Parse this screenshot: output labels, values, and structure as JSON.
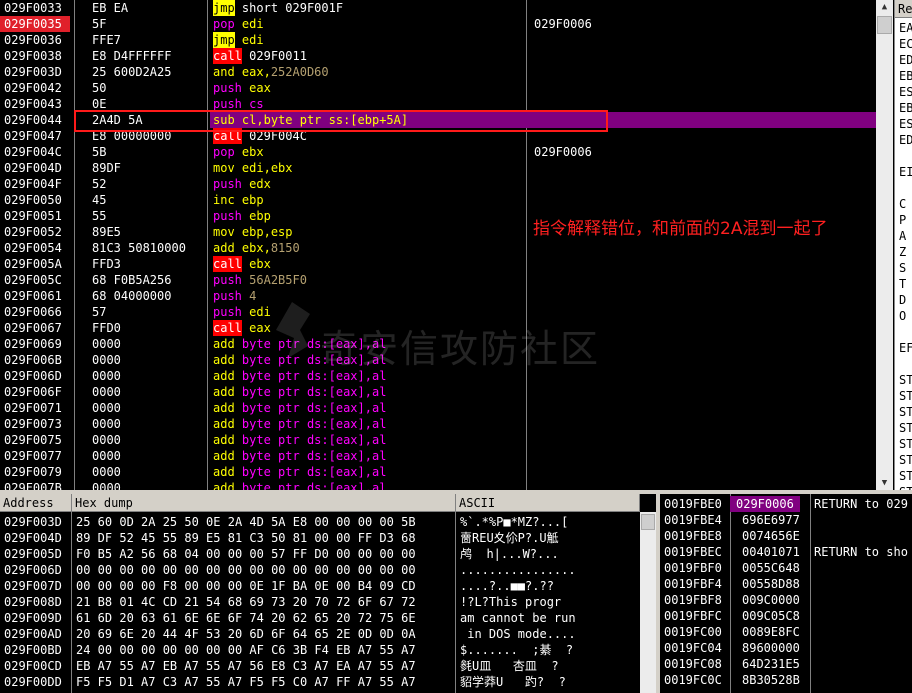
{
  "disasm": [
    {
      "addr": "029F0033",
      "hex": "EB EA",
      "mn": "jmp",
      "mnc": "m-jmp",
      "ops": [
        {
          "t": "short 029F001F",
          "c": ""
        }
      ],
      "cmt": ""
    },
    {
      "addr": "029F0035",
      "hex": "5F",
      "mn": "pop",
      "mnc": "m-pop",
      "ops": [
        {
          "t": "edi",
          "c": "op-y"
        }
      ],
      "cmt": "029F0006",
      "hl": true
    },
    {
      "addr": "029F0036",
      "hex": "FFE7",
      "mn": "jmp",
      "mnc": "m-jmp",
      "ops": [
        {
          "t": "edi",
          "c": "op-y"
        }
      ],
      "cmt": ""
    },
    {
      "addr": "029F0038",
      "hex": "E8 D4FFFFFF",
      "mn": "call",
      "mnc": "m-call",
      "ops": [
        {
          "t": "029F0011",
          "c": ""
        }
      ],
      "cmt": ""
    },
    {
      "addr": "029F003D",
      "hex": "25 600D2A25",
      "mn": "and",
      "mnc": "m-and",
      "ops": [
        {
          "t": "eax,",
          "c": "op-y"
        },
        {
          "t": "252A0D60",
          "c": "op-o"
        }
      ],
      "cmt": ""
    },
    {
      "addr": "029F0042",
      "hex": "50",
      "mn": "push",
      "mnc": "m-push",
      "ops": [
        {
          "t": "eax",
          "c": "op-y"
        }
      ],
      "cmt": ""
    },
    {
      "addr": "029F0043",
      "hex": "0E",
      "mn": "push",
      "mnc": "m-push",
      "ops": [
        {
          "t": "cs",
          "c": "op-m"
        }
      ],
      "cmt": ""
    },
    {
      "addr": "029F0044",
      "hex": "2A4D 5A",
      "mn": "sub",
      "mnc": "m-sub",
      "ops": [
        {
          "t": "cl,byte ptr ss:[ebp+5A]",
          "c": "op-y"
        }
      ],
      "cmt": "",
      "sel": true
    },
    {
      "addr": "029F0047",
      "hex": "E8 00000000",
      "mn": "call",
      "mnc": "m-call",
      "ops": [
        {
          "t": "029F004C",
          "c": ""
        }
      ],
      "cmt": ""
    },
    {
      "addr": "029F004C",
      "hex": "5B",
      "mn": "pop",
      "mnc": "m-pop",
      "ops": [
        {
          "t": "ebx",
          "c": "op-y"
        }
      ],
      "cmt": "029F0006"
    },
    {
      "addr": "029F004D",
      "hex": "89DF",
      "mn": "mov",
      "mnc": "m-mov",
      "ops": [
        {
          "t": "edi,ebx",
          "c": "op-y"
        }
      ],
      "cmt": ""
    },
    {
      "addr": "029F004F",
      "hex": "52",
      "mn": "push",
      "mnc": "m-push",
      "ops": [
        {
          "t": "edx",
          "c": "op-y"
        }
      ],
      "cmt": ""
    },
    {
      "addr": "029F0050",
      "hex": "45",
      "mn": "inc",
      "mnc": "m-inc",
      "ops": [
        {
          "t": "ebp",
          "c": "op-y"
        }
      ],
      "cmt": ""
    },
    {
      "addr": "029F0051",
      "hex": "55",
      "mn": "push",
      "mnc": "m-push",
      "ops": [
        {
          "t": "ebp",
          "c": "op-y"
        }
      ],
      "cmt": ""
    },
    {
      "addr": "029F0052",
      "hex": "89E5",
      "mn": "mov",
      "mnc": "m-mov",
      "ops": [
        {
          "t": "ebp,esp",
          "c": "op-y"
        }
      ],
      "cmt": ""
    },
    {
      "addr": "029F0054",
      "hex": "81C3 50810000",
      "mn": "add",
      "mnc": "m-add",
      "ops": [
        {
          "t": "ebx,",
          "c": "op-y"
        },
        {
          "t": "8150",
          "c": "op-o"
        }
      ],
      "cmt": ""
    },
    {
      "addr": "029F005A",
      "hex": "FFD3",
      "mn": "call",
      "mnc": "m-call",
      "ops": [
        {
          "t": "ebx",
          "c": "op-y"
        }
      ],
      "cmt": ""
    },
    {
      "addr": "029F005C",
      "hex": "68 F0B5A256",
      "mn": "push",
      "mnc": "m-push",
      "ops": [
        {
          "t": "56A2B5F0",
          "c": "op-o"
        }
      ],
      "cmt": ""
    },
    {
      "addr": "029F0061",
      "hex": "68 04000000",
      "mn": "push",
      "mnc": "m-push",
      "ops": [
        {
          "t": "4",
          "c": "op-o"
        }
      ],
      "cmt": ""
    },
    {
      "addr": "029F0066",
      "hex": "57",
      "mn": "push",
      "mnc": "m-push",
      "ops": [
        {
          "t": "edi",
          "c": "op-y"
        }
      ],
      "cmt": ""
    },
    {
      "addr": "029F0067",
      "hex": "FFD0",
      "mn": "call",
      "mnc": "m-call",
      "ops": [
        {
          "t": "eax",
          "c": "op-y"
        }
      ],
      "cmt": ""
    },
    {
      "addr": "029F0069",
      "hex": "0000",
      "mn": "add",
      "mnc": "m-add",
      "ops": [
        {
          "t": "byte ptr ds:[eax],al",
          "c": "op-m"
        }
      ],
      "cmt": ""
    },
    {
      "addr": "029F006B",
      "hex": "0000",
      "mn": "add",
      "mnc": "m-add",
      "ops": [
        {
          "t": "byte ptr ds:[eax],al",
          "c": "op-m"
        }
      ],
      "cmt": ""
    },
    {
      "addr": "029F006D",
      "hex": "0000",
      "mn": "add",
      "mnc": "m-add",
      "ops": [
        {
          "t": "byte ptr ds:[eax],al",
          "c": "op-m"
        }
      ],
      "cmt": ""
    },
    {
      "addr": "029F006F",
      "hex": "0000",
      "mn": "add",
      "mnc": "m-add",
      "ops": [
        {
          "t": "byte ptr ds:[eax],al",
          "c": "op-m"
        }
      ],
      "cmt": ""
    },
    {
      "addr": "029F0071",
      "hex": "0000",
      "mn": "add",
      "mnc": "m-add",
      "ops": [
        {
          "t": "byte ptr ds:[eax],al",
          "c": "op-m"
        }
      ],
      "cmt": ""
    },
    {
      "addr": "029F0073",
      "hex": "0000",
      "mn": "add",
      "mnc": "m-add",
      "ops": [
        {
          "t": "byte ptr ds:[eax],al",
          "c": "op-m"
        }
      ],
      "cmt": ""
    },
    {
      "addr": "029F0075",
      "hex": "0000",
      "mn": "add",
      "mnc": "m-add",
      "ops": [
        {
          "t": "byte ptr ds:[eax],al",
          "c": "op-m"
        }
      ],
      "cmt": ""
    },
    {
      "addr": "029F0077",
      "hex": "0000",
      "mn": "add",
      "mnc": "m-add",
      "ops": [
        {
          "t": "byte ptr ds:[eax],al",
          "c": "op-m"
        }
      ],
      "cmt": ""
    },
    {
      "addr": "029F0079",
      "hex": "0000",
      "mn": "add",
      "mnc": "m-add",
      "ops": [
        {
          "t": "byte ptr ds:[eax],al",
          "c": "op-m"
        }
      ],
      "cmt": ""
    },
    {
      "addr": "029F007B",
      "hex": "0000",
      "mn": "add",
      "mnc": "m-add",
      "ops": [
        {
          "t": "byte ptr ds:[eax],al",
          "c": "op-m"
        }
      ],
      "cmt": ""
    }
  ],
  "annotation": "指令解释错位，和前面的2A混到一起了",
  "watermark": "奇安信攻防社区",
  "registers": {
    "header": "Re",
    "labels": [
      "EA",
      "EC",
      "ED",
      "EB",
      "ES",
      "EB",
      "ES",
      "ED",
      "",
      "EI",
      "",
      "C",
      "P",
      "A",
      "Z",
      "S",
      "T",
      "D",
      "O",
      "",
      "EF",
      "",
      "ST",
      "ST",
      "ST",
      "ST",
      "ST",
      "ST",
      "ST",
      "ST"
    ]
  },
  "dump": {
    "headers": {
      "address": "Address",
      "hex": "Hex dump",
      "ascii": "ASCII"
    },
    "rows": [
      {
        "addr": "029F003D",
        "hex": "25 60 0D 2A 25 50 0E 2A 4D 5A E8 00 00 00 00 5B",
        "ascii": "%`.*%P■*MZ?...["
      },
      {
        "addr": "029F004D",
        "hex": "89 DF 52 45 55 89 E5 81 C3 50 81 00 00 FF D3 68",
        "ascii": "夁REU夊伱P?.U觝"
      },
      {
        "addr": "029F005D",
        "hex": "F0 B5 A2 56 68 04 00 00 00 57 FF D0 00 00 00 00",
        "ascii": "鸬  h|...W?..."
      },
      {
        "addr": "029F006D",
        "hex": "00 00 00 00 00 00 00 00 00 00 00 00 00 00 00 00",
        "ascii": "................"
      },
      {
        "addr": "029F007D",
        "hex": "00 00 00 00 F8 00 00 00 0E 1F BA 0E 00 B4 09 CD",
        "ascii": "....?..■■?.??"
      },
      {
        "addr": "029F008D",
        "hex": "21 B8 01 4C CD 21 54 68 69 73 20 70 72 6F 67 72",
        "ascii": "!?L?This progr"
      },
      {
        "addr": "029F009D",
        "hex": "61 6D 20 63 61 6E 6E 6F 74 20 62 65 20 72 75 6E",
        "ascii": "am cannot be run"
      },
      {
        "addr": "029F00AD",
        "hex": "20 69 6E 20 44 4F 53 20 6D 6F 64 65 2E 0D 0D 0A",
        "ascii": " in DOS mode...."
      },
      {
        "addr": "029F00BD",
        "hex": "24 00 00 00 00 00 00 00 AF C6 3B F4 EB A7 55 A7",
        "ascii": "$.......  ;綦  ?"
      },
      {
        "addr": "029F00CD",
        "hex": "EB A7 55 A7 EB A7 55 A7 56 E8 C3 A7 EA A7 55 A7",
        "ascii": "毵U皿   杏皿  ?"
      },
      {
        "addr": "029F00DD",
        "hex": "F5 F5 D1 A7 C3 A7 55 A7 F5 F5 C0 A7 FF A7 55 A7",
        "ascii": "貂学莽U   趵?  ?"
      }
    ]
  },
  "stack": {
    "rows": [
      {
        "addr": "0019FBE0",
        "val": "029F0006",
        "cmt": "RETURN to 029",
        "sel": true
      },
      {
        "addr": "0019FBE4",
        "val": "696E6977",
        "cmt": ""
      },
      {
        "addr": "0019FBE8",
        "val": "0074656E",
        "cmt": ""
      },
      {
        "addr": "0019FBEC",
        "val": "00401071",
        "cmt": "RETURN to sho"
      },
      {
        "addr": "0019FBF0",
        "val": "0055C648",
        "cmt": ""
      },
      {
        "addr": "0019FBF4",
        "val": "00558D88",
        "cmt": ""
      },
      {
        "addr": "0019FBF8",
        "val": "009C0000",
        "cmt": ""
      },
      {
        "addr": "0019FBFC",
        "val": "009C05C8",
        "cmt": ""
      },
      {
        "addr": "0019FC00",
        "val": "0089E8FC",
        "cmt": ""
      },
      {
        "addr": "0019FC04",
        "val": "89600000",
        "cmt": ""
      },
      {
        "addr": "0019FC08",
        "val": "64D231E5",
        "cmt": ""
      },
      {
        "addr": "0019FC0C",
        "val": "8B30528B",
        "cmt": ""
      }
    ]
  }
}
